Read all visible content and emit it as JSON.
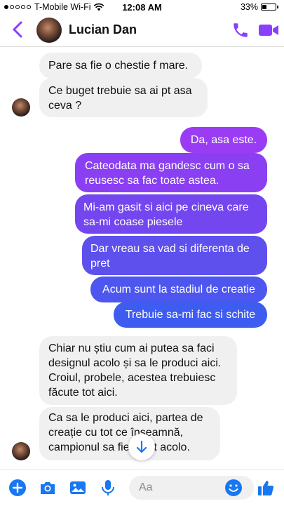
{
  "status_bar": {
    "carrier": "T-Mobile Wi-Fi",
    "time": "12:08 AM",
    "battery": "33%",
    "battery_level": 0.33,
    "signal_bars_filled": 1,
    "signal_bars_total": 5
  },
  "header": {
    "contact_name": "Lucian Dan",
    "accent_color": "#8a3ffc"
  },
  "messages": [
    {
      "direction": "in",
      "text": "Pare sa fie o chestie f mare."
    },
    {
      "direction": "in",
      "text": "Ce buget trebuie sa ai pt asa ceva ?"
    },
    {
      "direction": "out",
      "text": "Da, asa este."
    },
    {
      "direction": "out",
      "text": "Cateodata ma gandesc cum o sa reusesc sa fac toate astea."
    },
    {
      "direction": "out",
      "text": "Mi-am gasit si aici pe cineva care sa-mi coase piesele"
    },
    {
      "direction": "out",
      "text": "Dar vreau sa vad si diferenta de pret"
    },
    {
      "direction": "out",
      "text": "Acum sunt la stadiul de creatie"
    },
    {
      "direction": "out",
      "text": "Trebuie sa-mi fac si schite"
    },
    {
      "direction": "in",
      "text": "Chiar nu știu cum ai putea sa faci designul acolo și sa le produci aici. Croiul, probele, acestea trebuiesc făcute tot aici."
    },
    {
      "direction": "in",
      "text": "Ca sa le produci aici, partea de creație cu tot ce înseamnă, campionul sa fie făcut acolo."
    }
  ],
  "composer": {
    "placeholder": "Aa"
  },
  "colors": {
    "accent": "#8a3ffc",
    "out_gradient_top": "#9b3cf5",
    "out_gradient_bottom": "#3c5cf0",
    "in_bubble": "#f1f0f0"
  },
  "icons": {
    "back": "chevron-left-icon",
    "call": "phone-icon",
    "video": "video-camera-icon",
    "scroll_down": "arrow-down-icon",
    "plus": "plus-icon",
    "camera": "camera-icon",
    "gallery": "image-icon",
    "mic": "microphone-icon",
    "emoji": "emoji-icon",
    "like": "thumbs-up-icon"
  }
}
